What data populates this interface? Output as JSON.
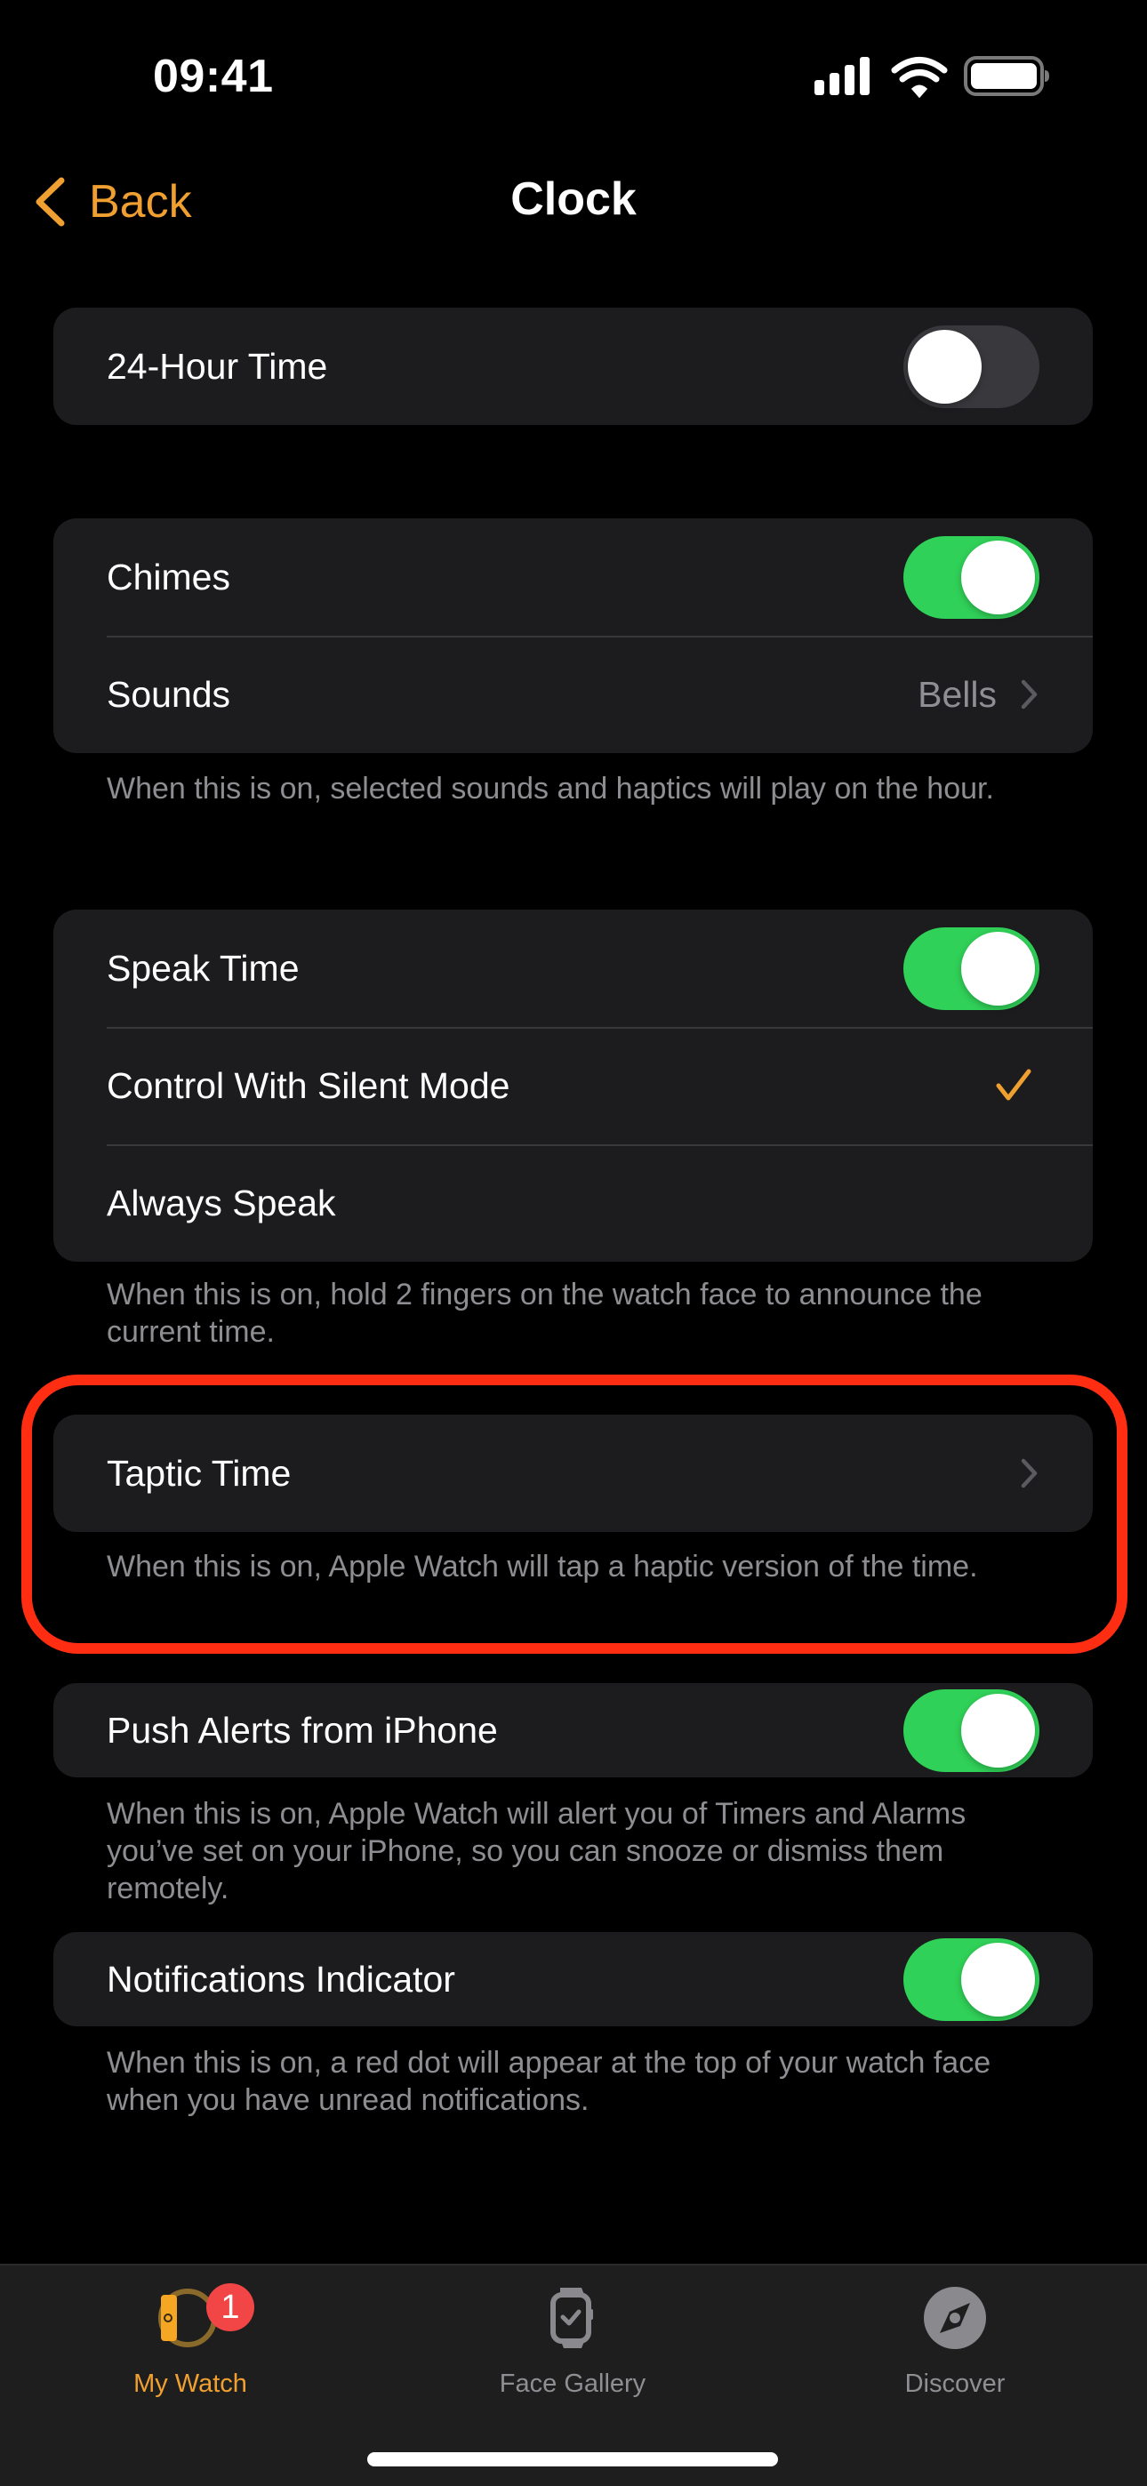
{
  "status_bar": {
    "time": "09:41",
    "icons": [
      "cellular-signal-icon",
      "wifi-icon",
      "battery-icon"
    ]
  },
  "nav": {
    "back_label": "Back",
    "title": "Clock"
  },
  "colors": {
    "accent": "#f0a030",
    "toggle_on": "#30d158",
    "toggle_off": "#39393d",
    "card_bg": "#1c1c1e",
    "highlight": "#ff2d12",
    "badge": "#f24545"
  },
  "sections": [
    {
      "rows": [
        {
          "label": "24-Hour Time",
          "type": "toggle",
          "on": false
        }
      ]
    },
    {
      "rows": [
        {
          "label": "Chimes",
          "type": "toggle",
          "on": true
        },
        {
          "label": "Sounds",
          "type": "disclosure",
          "value": "Bells"
        }
      ],
      "footer": "When this is on, selected sounds and haptics will play on the hour."
    },
    {
      "rows": [
        {
          "label": "Speak Time",
          "type": "toggle",
          "on": true
        },
        {
          "label": "Control With Silent Mode",
          "type": "check",
          "checked": true
        },
        {
          "label": "Always Speak",
          "type": "check",
          "checked": false
        }
      ],
      "footer": "When this is on, hold 2 fingers on the watch face to announce the current time."
    },
    {
      "rows": [
        {
          "label": "Taptic Time",
          "type": "disclosure"
        }
      ],
      "footer": "When this is on, Apple Watch will tap a haptic version of the time.",
      "highlighted": true
    },
    {
      "rows": [
        {
          "label": "Push Alerts from iPhone",
          "type": "toggle",
          "on": true
        }
      ],
      "footer": "When this is on, Apple Watch will alert you of Timers and Alarms you’ve set on your iPhone, so you can snooze or dismiss them remotely."
    },
    {
      "rows": [
        {
          "label": "Notifications Indicator",
          "type": "toggle",
          "on": true
        }
      ],
      "footer": "When this is on, a red dot will appear at the top of your watch face when you have unread notifications."
    }
  ],
  "tabbar": {
    "tabs": [
      {
        "label": "My Watch",
        "icon": "my-watch-icon",
        "active": true,
        "badge": "1"
      },
      {
        "label": "Face Gallery",
        "icon": "face-gallery-icon",
        "active": false
      },
      {
        "label": "Discover",
        "icon": "compass-icon",
        "active": false
      }
    ]
  }
}
